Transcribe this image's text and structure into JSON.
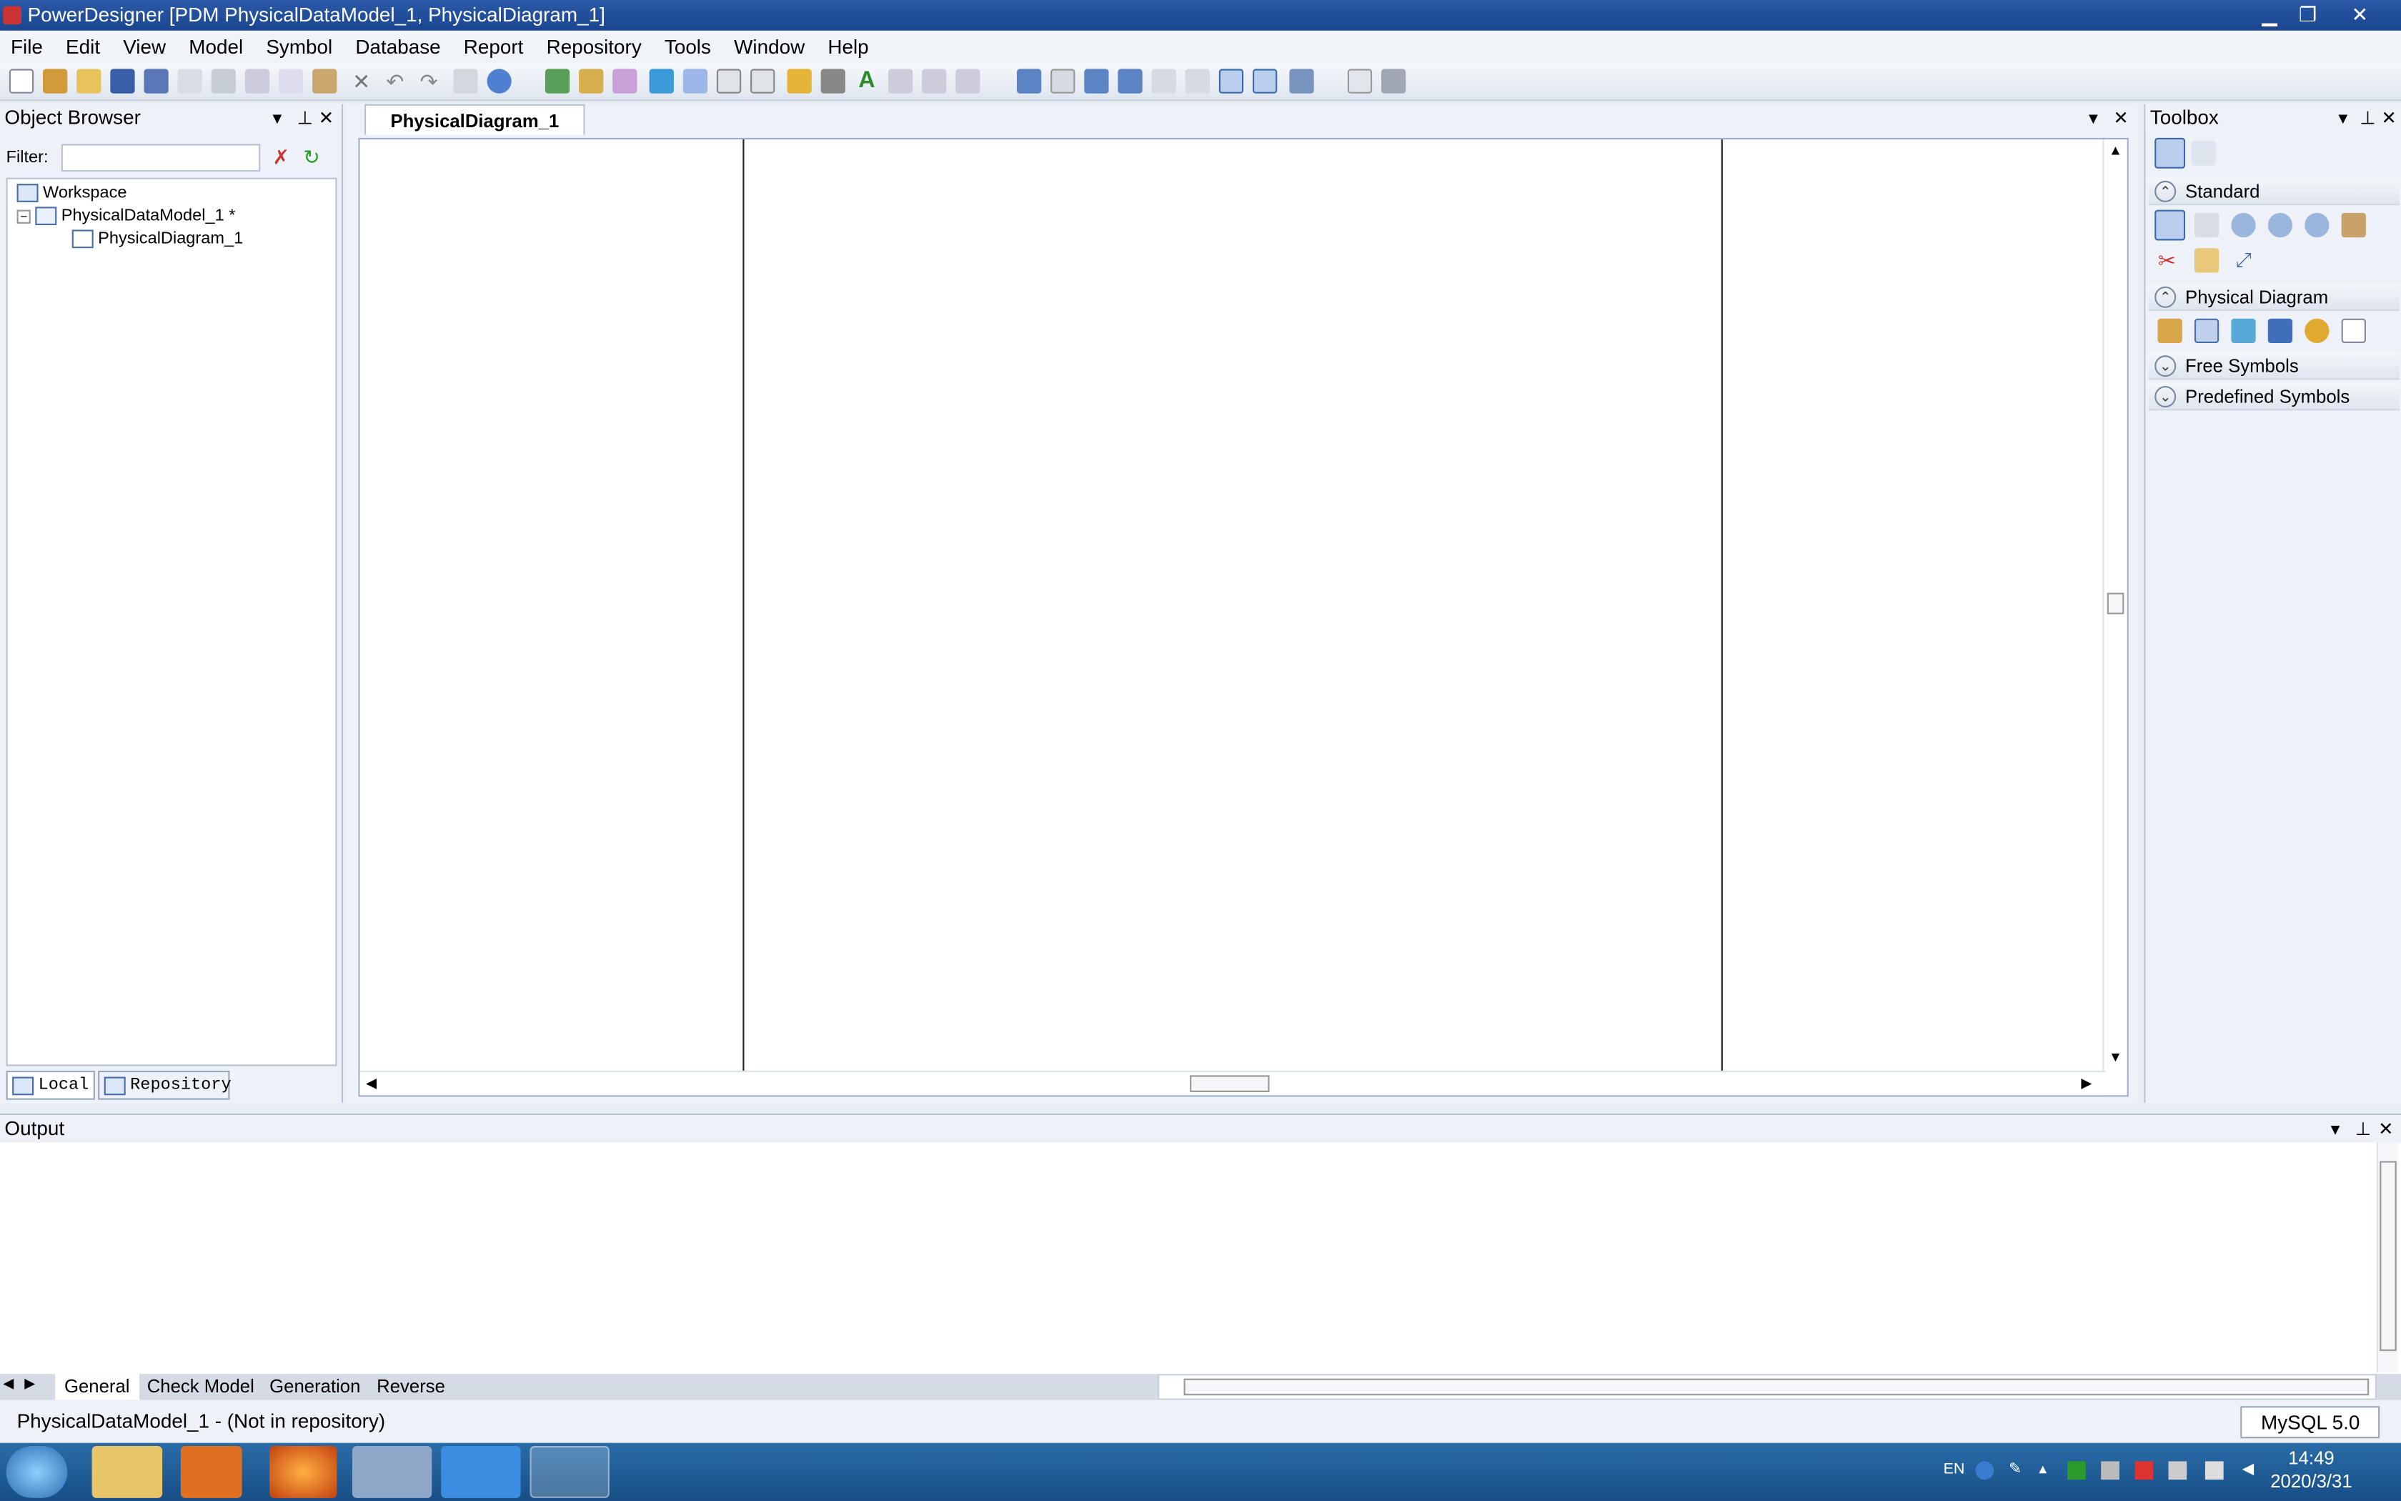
{
  "window": {
    "title": "PowerDesigner [PDM PhysicalDataModel_1, PhysicalDiagram_1]",
    "controls": {
      "minimize": "▁",
      "restore": "❐",
      "close": "✕"
    }
  },
  "menu": [
    "File",
    "Edit",
    "View",
    "Model",
    "Symbol",
    "Database",
    "Report",
    "Repository",
    "Tools",
    "Window",
    "Help"
  ],
  "object_browser": {
    "title": "Object Browser",
    "filter_label": "Filter:",
    "filter_value": "",
    "tree": [
      {
        "label": "Workspace",
        "icon": "workspace-icon"
      },
      {
        "label": "PhysicalDataModel_1 *",
        "icon": "model-icon"
      },
      {
        "label": "PhysicalDiagram_1",
        "icon": "diagram-icon"
      }
    ],
    "tabs": [
      "Local",
      "Repository"
    ]
  },
  "diagram": {
    "tab_label": "PhysicalDiagram_1"
  },
  "toolbox": {
    "title": "Toolbox",
    "sections": [
      {
        "label": "Standard",
        "state": "expanded"
      },
      {
        "label": "Physical Diagram",
        "state": "expanded"
      },
      {
        "label": "Free Symbols",
        "state": "collapsed"
      },
      {
        "label": "Predefined Symbols",
        "state": "collapsed"
      }
    ]
  },
  "output": {
    "title": "Output",
    "tabs": [
      "General",
      "Check Model",
      "Generation",
      "Reverse"
    ]
  },
  "statusbar": {
    "text": "PhysicalDataModel_1 - (Not in repository)",
    "dbms": "MySQL 5.0"
  },
  "taskbar": {
    "lang": "EN",
    "time": "14:49",
    "date": "2020/3/31"
  },
  "colors": {
    "titlebar": "#1a4590",
    "taskbar": "#174e85",
    "panel": "#eef2f8"
  }
}
